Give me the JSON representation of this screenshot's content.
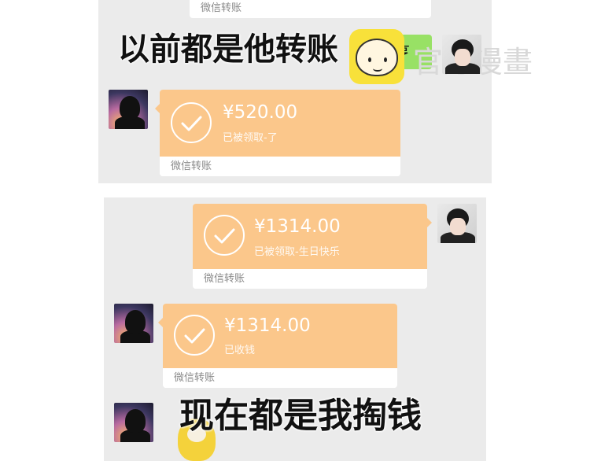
{
  "top_panel": {
    "stub_label": "微信转账",
    "caption": "以前都是他转账",
    "green_bubble_text": "亨",
    "transfer": {
      "amount": "¥520.00",
      "note": "已被领取-了",
      "footer": "微信转账"
    }
  },
  "watermark": "官方漫畫",
  "bottom_panel": {
    "transfer_sent": {
      "amount": "¥1314.00",
      "note": "已被领取-生日快乐",
      "footer": "微信转账"
    },
    "transfer_received": {
      "amount": "¥1314.00",
      "note": "已收钱",
      "footer": "微信转账"
    },
    "caption": "现在都是我掏钱"
  },
  "colors": {
    "panel_bg": "#ebebeb",
    "transfer_orange": "#fbc78b",
    "wechat_green": "#98e165"
  }
}
